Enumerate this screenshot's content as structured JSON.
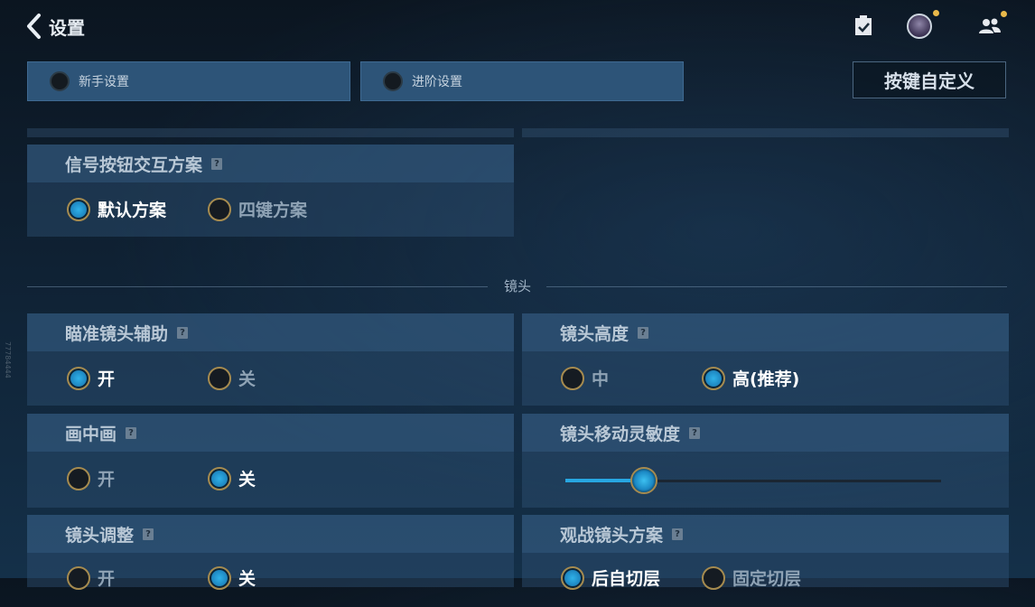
{
  "header": {
    "title": "设置"
  },
  "mode_tabs": [
    {
      "label": "新手设置"
    },
    {
      "label": "进阶设置"
    }
  ],
  "custom_keys_button": "按键自定义",
  "signal": {
    "title": "信号按钮交互方案",
    "options": [
      "默认方案",
      "四键方案"
    ],
    "selected": "默认方案"
  },
  "section_camera": "镜头",
  "aim_assist": {
    "title": "瞄准镜头辅助",
    "options": [
      "开",
      "关"
    ],
    "selected": "开"
  },
  "camera_height": {
    "title": "镜头高度",
    "options": [
      "中",
      "高(推荐)"
    ],
    "selected": "高(推荐)"
  },
  "pip": {
    "title": "画中画",
    "options": [
      "开",
      "关"
    ],
    "selected": "关"
  },
  "camera_sensitivity": {
    "title": "镜头移动灵敏度",
    "value_fraction": 0.21
  },
  "camera_adjust": {
    "title": "镜头调整",
    "options": [
      "开",
      "关"
    ]
  },
  "spectate_camera": {
    "title": "观战镜头方案",
    "options": [
      "后自切层",
      "固定切层"
    ]
  },
  "side_watermark": "77784444",
  "icon_help": "?",
  "colors": {
    "accent_blue": "#27a7e2",
    "gold": "#a68b4f",
    "badge": "#e9b94a"
  }
}
